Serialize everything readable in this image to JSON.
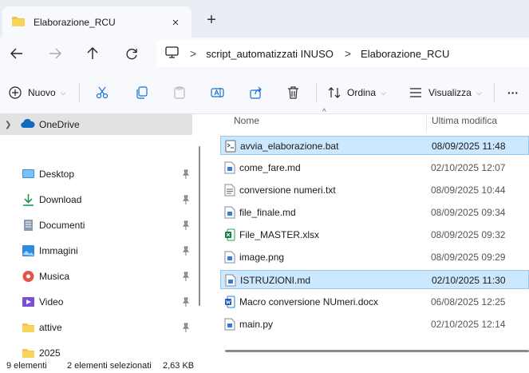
{
  "tab": {
    "title": "Elaborazione_RCU",
    "close_icon": "×",
    "new_tab_icon": "+"
  },
  "address": {
    "breadcrumbs": [
      "script_automatizzati INUSO",
      "Elaborazione_RCU"
    ],
    "separator": ">"
  },
  "toolbar": {
    "new_label": "Nuovo",
    "sort_label": "Ordina",
    "view_label": "Visualizza",
    "more_label": "···"
  },
  "navpane": {
    "onedrive_label": "OneDrive",
    "items": [
      {
        "label": "Desktop",
        "icon": "desktop-icon",
        "pinned": true
      },
      {
        "label": "Download",
        "icon": "download-icon",
        "pinned": true
      },
      {
        "label": "Documenti",
        "icon": "documents-icon",
        "pinned": true
      },
      {
        "label": "Immagini",
        "icon": "pictures-icon",
        "pinned": true
      },
      {
        "label": "Musica",
        "icon": "music-icon",
        "pinned": true
      },
      {
        "label": "Video",
        "icon": "video-icon",
        "pinned": true
      },
      {
        "label": "attive",
        "icon": "folder-icon",
        "pinned": true
      },
      {
        "label": "2025",
        "icon": "folder-icon",
        "pinned": false
      }
    ]
  },
  "filelist": {
    "columns": {
      "name": "Nome",
      "modified": "Ultima modifica"
    },
    "files": [
      {
        "name": "avvia_elaborazione.bat",
        "modified": "08/09/2025 11:48",
        "type": "bat",
        "selected": true
      },
      {
        "name": "come_fare.md",
        "modified": "02/10/2025 12:07",
        "type": "md",
        "selected": false
      },
      {
        "name": "conversione numeri.txt",
        "modified": "08/09/2025 10:44",
        "type": "txt",
        "selected": false
      },
      {
        "name": "file_finale.md",
        "modified": "08/09/2025 09:34",
        "type": "md",
        "selected": false
      },
      {
        "name": "File_MASTER.xlsx",
        "modified": "08/09/2025 09:32",
        "type": "xlsx",
        "selected": false
      },
      {
        "name": "image.png",
        "modified": "08/09/2025 09:29",
        "type": "png",
        "selected": false
      },
      {
        "name": "ISTRUZIONI.md",
        "modified": "02/10/2025 11:30",
        "type": "md",
        "selected": true
      },
      {
        "name": "Macro conversione NUmeri.docx",
        "modified": "06/08/2025 12:25",
        "type": "docx",
        "selected": false
      },
      {
        "name": "main.py",
        "modified": "02/10/2025 12:14",
        "type": "py",
        "selected": false
      }
    ]
  },
  "status": {
    "count": "9 elementi",
    "selection": "2 elementi selezionati",
    "size": "2,63 KB"
  },
  "colors": {
    "accent": "#0067c0",
    "selection": "#cce8ff",
    "folder": "#f4c545"
  }
}
